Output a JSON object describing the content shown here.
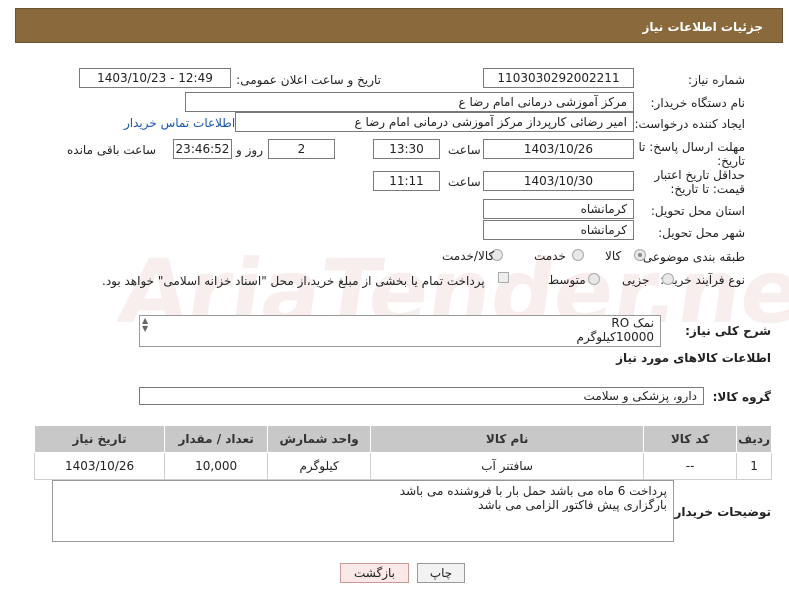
{
  "header": {
    "title": "جزئیات اطلاعات نیاز"
  },
  "form": {
    "need_number_label": "شماره نیاز:",
    "need_number": "1103030292002211",
    "announce_label": "تاریخ و ساعت اعلان عمومی:",
    "announce_value": "1403/10/23 - 12:49",
    "buyer_label": "نام دستگاه خریدار:",
    "buyer_value": "مرکز آموزشی  درمانی امام رضا  ع",
    "creator_label": "ایجاد کننده درخواست:",
    "creator_value": "امیر رضائی کارپرداز مرکز آموزشی  درمانی امام رضا  ع",
    "buyer_contact_link": "اطلاعات تماس خریدار",
    "deadline_label": "مهلت ارسال پاسخ: تا تاریخ:",
    "deadline_date": "1403/10/26",
    "time_label": "ساعت",
    "deadline_time": "13:30",
    "days_value": "2",
    "days_label": "روز و",
    "remaining_time": "23:46:52",
    "remaining_label": "ساعت باقی مانده",
    "validity_label": "حداقل تاریخ اعتبار قیمت: تا تاریخ:",
    "validity_date": "1403/10/30",
    "validity_time": "11:11",
    "province_label": "استان محل تحویل:",
    "province_value": "کرمانشاه",
    "city_label": "شهر محل تحویل:",
    "city_value": "کرمانشاه",
    "category_label": "طبقه بندی موضوعی:",
    "category_options": [
      "کالا",
      "خدمت",
      "کالا/خدمت"
    ],
    "category_selected": "کالا",
    "process_label": "نوع فرآیند خرید :",
    "process_options": [
      "جزیی",
      "متوسط"
    ],
    "payment_note": "پرداخت تمام یا بخشی از مبلغ خرید،از محل \"اسناد خزانه اسلامی\" خواهد بود."
  },
  "description": {
    "label": "شرح کلی نیاز:",
    "line1": "نمک RO",
    "line2": "10000کیلوگرم"
  },
  "goods": {
    "section_title": "اطلاعات کالاهای مورد نیاز",
    "group_label": "گروه کالا:",
    "group_value": "دارو، پزشکی و سلامت",
    "columns": [
      "ردیف",
      "کد کالا",
      "نام کالا",
      "واحد شمارش",
      "تعداد / مقدار",
      "تاریخ نیاز"
    ],
    "rows": [
      {
        "row": "1",
        "code": "--",
        "name": "سافتنر آب",
        "unit": "کیلوگرم",
        "qty": "10,000",
        "date": "1403/10/26"
      }
    ]
  },
  "buyer_notes": {
    "label": "توضیحات خریدار:",
    "line1": "پرداخت 6 ماه می باشد حمل بار با فروشنده می باشد",
    "line2": "بارگزاری پیش فاکتور الزامی می باشد"
  },
  "buttons": {
    "print": "چاپ",
    "back": "بازگشت"
  },
  "watermark": "AriaTender.neT",
  "colors": {
    "header_bg": "#8a6a3d",
    "link": "#1a56b0",
    "back_button_bg": "#fde8e8"
  }
}
